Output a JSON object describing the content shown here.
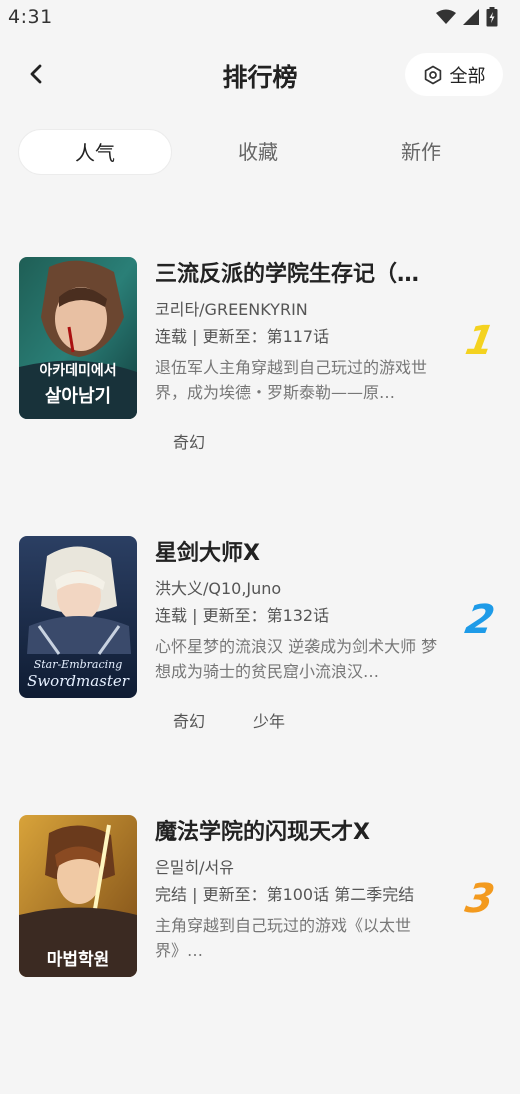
{
  "status": {
    "time": "4:31"
  },
  "header": {
    "title": "排行榜",
    "filter_label": "全部"
  },
  "tabs": [
    {
      "label": "人气",
      "active": true
    },
    {
      "label": "收藏",
      "active": false
    },
    {
      "label": "新作",
      "active": false
    }
  ],
  "items": [
    {
      "title": "三流反派的学院生存记（…",
      "author": "코리타/GREENKYRIN",
      "update": "连载 | 更新至：第117话",
      "desc": "退伍军人主角穿越到自己玩过的游戏世界，成为埃德・罗斯泰勒——原…",
      "tags": [
        "奇幻"
      ],
      "rank": "1",
      "rank_color": "#f4d21f",
      "cover_text": "아카데미에서 살아남기"
    },
    {
      "title": "星剑大师X",
      "author": "洪大义/Q10,Juno",
      "update": "连载 | 更新至：第132话",
      "desc": "心怀星梦的流浪汉 逆袭成为剑术大师 梦想成为骑士的贫民窟小流浪汉…",
      "tags": [
        "奇幻",
        "少年"
      ],
      "rank": "2",
      "rank_color": "#1e9be8",
      "cover_text": "Star-Embracing Swordmaster"
    },
    {
      "title": "魔法学院的闪现天才X",
      "author": "은밀히/서유",
      "update": "完结 | 更新至：第100话 第二季完结",
      "desc": "主角穿越到自己玩过的游戏《以太世界》…",
      "tags": [],
      "rank": "3",
      "rank_color": "#f39a1e",
      "cover_text": "마법학원"
    }
  ],
  "colors": {
    "background": "#f5f5f5",
    "card": "#ffffff",
    "text": "#222222"
  }
}
